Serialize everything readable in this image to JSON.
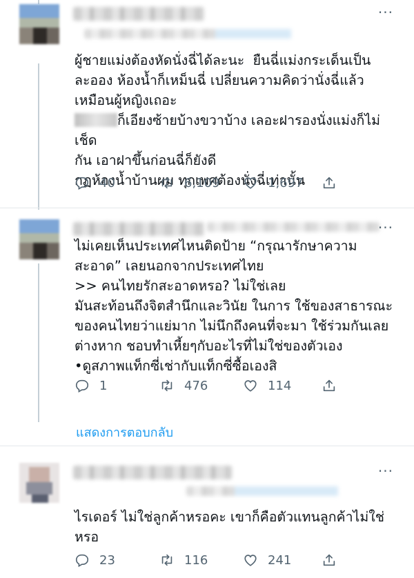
{
  "ui": {
    "more_glyph": "···",
    "accent": "#1d9bf0",
    "muted": "#536471"
  },
  "tweets": [
    {
      "text_before_blur": "ผู้ชายแม่งต้องหัดนั่งฉี่ได้ละนะ  ยืนฉี่แม่งกระเด็นเป็น\nละออง ห้องน้ำก็เหม็นฉี่ เปลี่ยนความคิดว่านั่งฉี่แล้ว\nเหมือนผู้หญิงเถอะ\n",
      "text_after_blur": "ก็เอียงซ้ายบ้างขวาบ้าง เลอะฝารองนั่งแม่งก็ไม่เช็ด\nกัน เอาฝาขึ้นก่อนฉี่ก็ยังดี\nกฏห้องน้ำบ้านผม ทุกเพศต้องนั่งฉี่เท่านั้น",
      "replies": "40",
      "retweets": "6,109",
      "likes": "1,697"
    },
    {
      "text": "ไม่เคยเห็นประเทศไหนติดป้าย “กรุณารักษาความ\nสะอาด” เลยนอกจากประเทศไทย\n>> คนไทยรักสะอาดหรอ? ไม่ใช่เลย\nมันสะท้อนถึงจิตสำนึกและวินัย ในการ ใช้ของสาธารณะ\nของคนไทยว่าแย่มาก ไม่นึกถึงคนที่จะมา ใช้ร่วมกันเลย\nต่างหาก ชอบทำเหี้ยๆกับอะไรที่ไม่ใช่ของตัวเอง\n•ดูสภาพแท็กซี่เช่ากับแท็กซี่ซื้อเองสิ",
      "replies": "1",
      "retweets": "476",
      "likes": "114"
    },
    {
      "text": "ไรเดอร์ ไม่ใช่ลูกค้าหรอคะ เขาก็คือตัวแทนลูกค้าไม่ใช่\nหรอ",
      "replies": "23",
      "retweets": "116",
      "likes": "241"
    }
  ],
  "show_replies_label": "แสดงการตอบกลับ",
  "icons": {
    "reply": "reply-icon",
    "retweet": "retweet-icon",
    "like": "heart-icon",
    "share": "share-icon"
  }
}
